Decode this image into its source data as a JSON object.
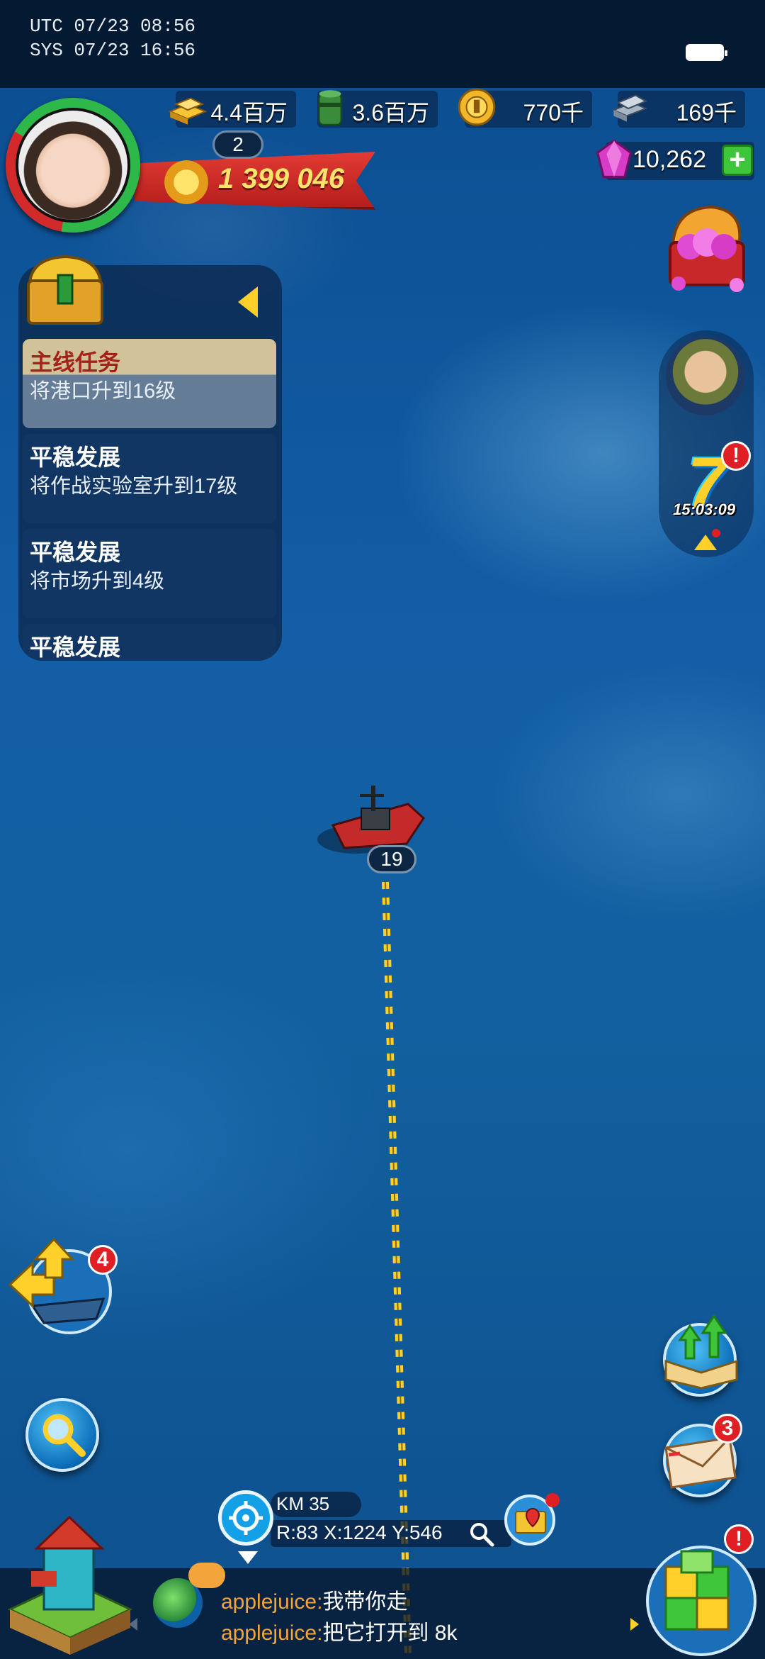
{
  "status_bar": {
    "utc": "UTC 07/23 08:56",
    "sys": "SYS 07/23 16:56"
  },
  "resources": {
    "gold": "4.4百万",
    "oil": "3.6百万",
    "coin": "770千",
    "steel": "169千",
    "gems": "10,262"
  },
  "player": {
    "level": "2",
    "power": "1 399 046"
  },
  "hero": {
    "timer": "15:03:09"
  },
  "badges": {
    "hero_alert": "!",
    "build_alert": "!",
    "fleet_count": "4",
    "mail_count": "3"
  },
  "quests": [
    {
      "title": "主线任务",
      "desc": "将港口升到16级"
    },
    {
      "title": "平稳发展",
      "desc": "将作战实验室升到17级"
    },
    {
      "title": "平稳发展",
      "desc": "将市场升到4级"
    },
    {
      "title": "平稳发展",
      "desc": ""
    }
  ],
  "ship": {
    "level": "19"
  },
  "coords": {
    "km": "KM 35",
    "position": "R:83 X:1224 Y:546"
  },
  "chat": [
    {
      "name": "applejuice:",
      "msg": "我带你走"
    },
    {
      "name": "applejuice:",
      "msg": "把它打开到 8k"
    }
  ],
  "icons": [
    "gold-icon",
    "oil-icon",
    "coin-icon",
    "steel-icon",
    "gem-icon",
    "plus-icon",
    "eagle-icon",
    "treasure-chest-icon",
    "hero-portrait-icon",
    "seven-event-icon",
    "quest-chest-icon",
    "ship-icon",
    "route-arrows",
    "fleet-icon",
    "search-icon",
    "upgrade-book-icon",
    "mail-icon",
    "locate-icon",
    "map-pin-icon",
    "globe-icon",
    "chat-bubble-icon",
    "home-base-icon",
    "build-blocks-icon"
  ],
  "colors": {
    "accent_gold": "#ffd02a",
    "alert_red": "#e01f25",
    "power_red": "#c42a24",
    "quest_title_red": "#a4221a",
    "chat_name": "#f3a43a"
  }
}
